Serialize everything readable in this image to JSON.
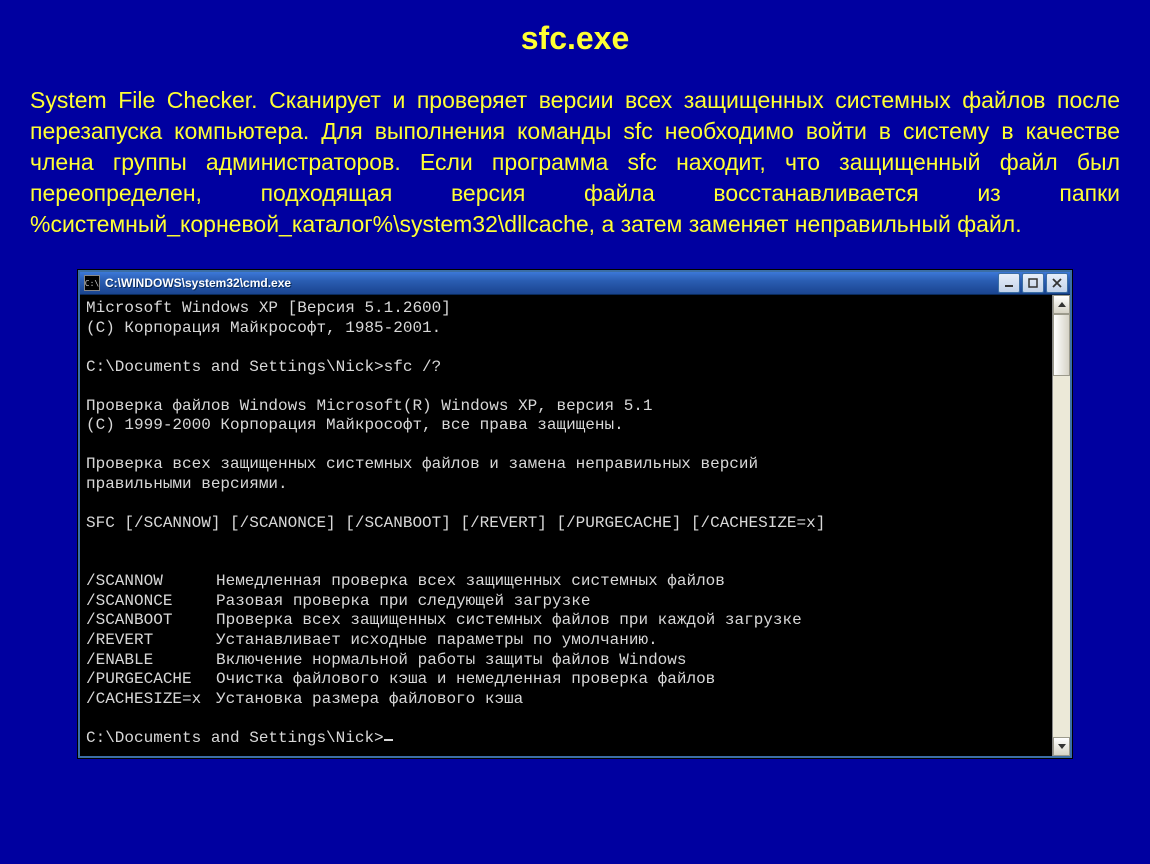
{
  "slide": {
    "title": "sfc.exe",
    "body": "System File Checker. Сканирует и проверяет версии всех защищенных системных файлов после перезапуска компьютера. Для выполнения команды sfc необходимо войти в систему в качестве члена группы администраторов. Если программа sfc находит, что защищенный файл был переопределен, подходящая версия файла восстанавливается из папки %системный_корневой_каталог%\\system32\\dllcache, а затем заменяет неправильный файл."
  },
  "cmd": {
    "titlebar_text": "C:\\WINDOWS\\system32\\cmd.exe",
    "icon_glyph": "C:\\",
    "lines": {
      "l1": "Microsoft Windows XP [Версия 5.1.2600]",
      "l2": "(С) Корпорация Майкрософт, 1985-2001.",
      "l3": "",
      "l4": "C:\\Documents and Settings\\Nick>sfc /?",
      "l5": "",
      "l6": "Проверка файлов Windows Microsoft(R) Windows XP, версия 5.1",
      "l7": "(C) 1999-2000 Корпорация Майкрософт, все права защищены.",
      "l8": "",
      "l9": "Проверка всех защищенных системных файлов и замена неправильных версий",
      "l10": "правильными версиями.",
      "l11": "",
      "l12": "SFC [/SCANNOW] [/SCANONCE] [/SCANBOOT] [/REVERT] [/PURGECACHE] [/CACHESIZE=x]",
      "l13": "",
      "l14": ""
    },
    "flags": [
      {
        "flag": "/SCANNOW",
        "desc": "Немедленная проверка всех защищенных системных файлов"
      },
      {
        "flag": "/SCANONCE",
        "desc": "Разовая проверка при следующей загрузке"
      },
      {
        "flag": "/SCANBOOT",
        "desc": "Проверка всех защищенных системных файлов при каждой загрузке"
      },
      {
        "flag": "/REVERT",
        "desc": "Устанавливает исходные параметры по умолчанию."
      },
      {
        "flag": "/ENABLE",
        "desc": "Включение нормальной работы защиты файлов Windows"
      },
      {
        "flag": "/PURGECACHE",
        "desc": "Очистка файлового кэша и немедленная проверка файлов"
      },
      {
        "flag": "/CACHESIZE=x",
        "desc": "Установка размера файлового кэша"
      }
    ],
    "prompt": "C:\\Documents and Settings\\Nick>"
  }
}
